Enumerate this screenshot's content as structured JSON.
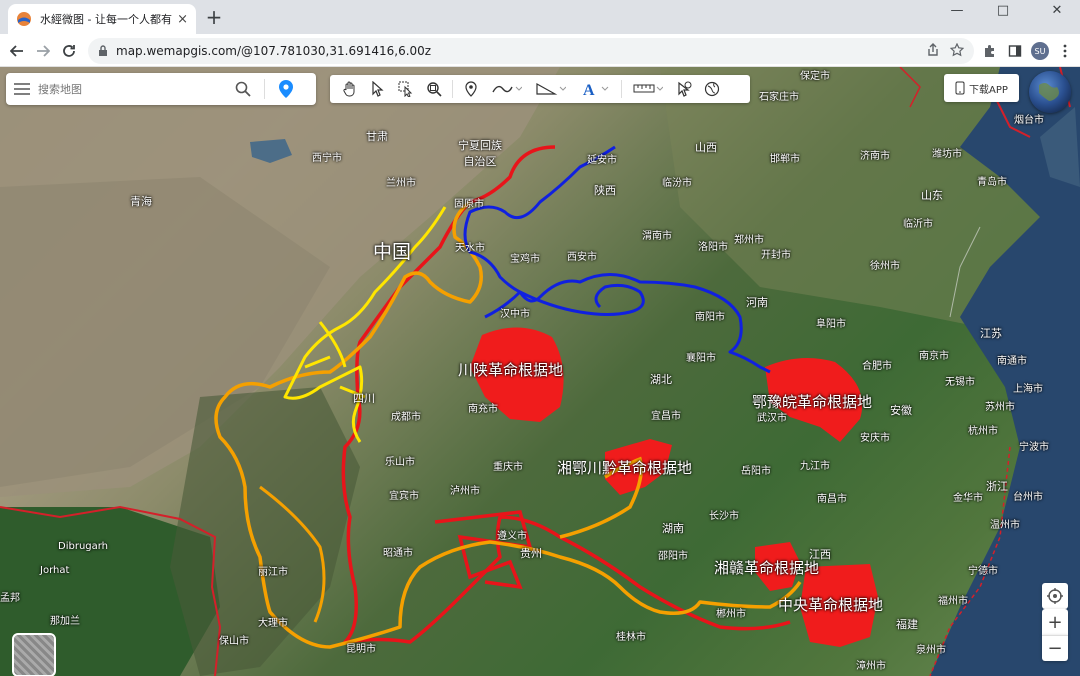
{
  "browser": {
    "tab_title": "水經微图 - 让每一个人都有自己",
    "tab_close": "×",
    "new_tab": "+",
    "window_controls": {
      "minimize": "—",
      "maximize": "□",
      "close": "✕"
    },
    "url": "map.wemapgis.com/@107.781030,31.691416,6.00z",
    "profile_initials": "SU"
  },
  "map_ui": {
    "search_placeholder": "搜索地图",
    "download_app": "下载APP",
    "zoom_in": "+",
    "zoom_out": "−"
  },
  "labels": {
    "country": "中国",
    "bases": [
      "川陕革命根据地",
      "鄂豫皖革命根据地",
      "湘鄂川黔革命根据地",
      "湘赣革命根据地",
      "中央革命根据地"
    ],
    "provinces": [
      "青海",
      "甘肃",
      "宁夏回族自治区",
      "陕西",
      "山西",
      "河南",
      "湖北",
      "四川",
      "湖南",
      "江西",
      "浙江",
      "江苏",
      "山东",
      "安徽",
      "福建",
      "贵州"
    ],
    "cities": [
      "西宁市",
      "兰州市",
      "固原市",
      "延安市",
      "西安市",
      "宝鸡市",
      "天水市",
      "汉中市",
      "渭南市",
      "洛阳市",
      "郑州市",
      "开封市",
      "南阳市",
      "襄阳市",
      "宜昌市",
      "武汉市",
      "岳阳市",
      "长沙市",
      "合肥市",
      "南京市",
      "无锡市",
      "苏州市",
      "上海市",
      "杭州市",
      "宁波市",
      "金华市",
      "台州市",
      "温州市",
      "南昌市",
      "福州市",
      "泉州市",
      "漳州市",
      "成都市",
      "南充市",
      "重庆市",
      "乐山市",
      "宜宾市",
      "泸州市",
      "遵义市",
      "昭通市",
      "丽江市",
      "大理市",
      "昆明市",
      "保山市",
      "桂林市",
      "郴州市",
      "邵阳市",
      "石家庄市",
      "保定市",
      "济南市",
      "潍坊市",
      "青岛市",
      "烟台市",
      "临沂市",
      "徐州市",
      "临汾市",
      "邯郸市",
      "南通市",
      "阜阳市",
      "安庆市",
      "九江市",
      "宁德市",
      "那加兰",
      "孟邦",
      "Dibrugarh",
      "Jorhat"
    ]
  },
  "colors": {
    "route_red": "#e8141a",
    "route_orange": "#f5a000",
    "route_yellow": "#ffe600",
    "route_blue": "#1020e0",
    "base_fill": "#f01c1c",
    "border_red": "#d4202a"
  },
  "icons": [
    "menu-icon",
    "search-icon",
    "location-pin-icon",
    "pan-hand-icon",
    "select-arrow-icon",
    "select-multi-icon",
    "zoom-box-icon",
    "marker-icon",
    "polyline-icon",
    "polygon-icon",
    "text-icon",
    "measure-icon",
    "info-pointer-icon",
    "globe-tool-icon",
    "phone-icon",
    "compass-icon"
  ]
}
